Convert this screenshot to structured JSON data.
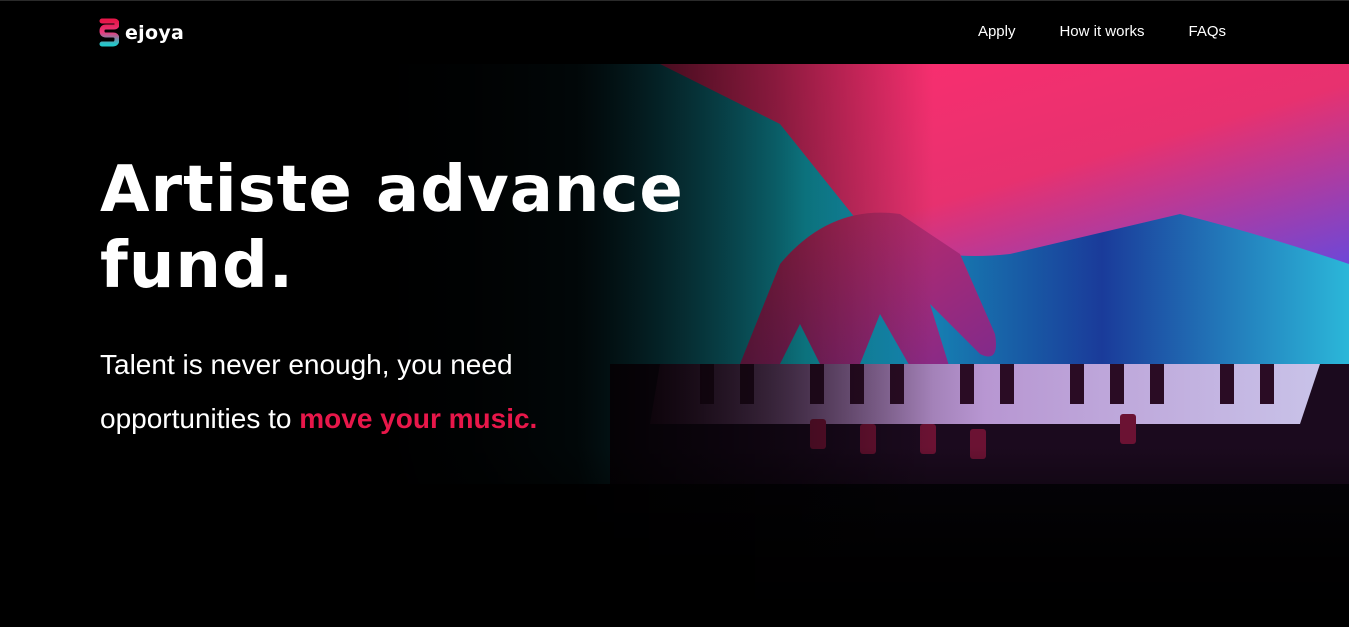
{
  "brand": {
    "name": "ejoya",
    "colors": {
      "primary": "#e8174a",
      "teal": "#25c6c9",
      "accent_text": "#e8174a"
    }
  },
  "nav": {
    "items": [
      {
        "label": "Apply"
      },
      {
        "label": "How it works"
      },
      {
        "label": "FAQs"
      }
    ]
  },
  "hero": {
    "headline": "Artiste advance fund.",
    "sub_prefix": "Talent is never enough, you need opportunities to ",
    "sub_highlight": "move your music.",
    "image_icon": "keyboard-photo"
  }
}
